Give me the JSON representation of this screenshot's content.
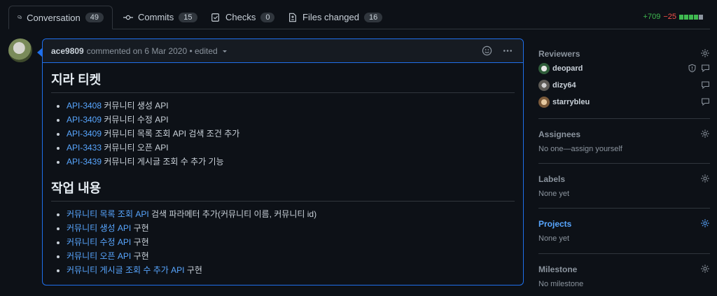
{
  "tabs": [
    {
      "label": "Conversation",
      "count": "49",
      "icon": "comment-discussion-icon"
    },
    {
      "label": "Commits",
      "count": "15",
      "icon": "commit-icon"
    },
    {
      "label": "Checks",
      "count": "0",
      "icon": "checklist-icon"
    },
    {
      "label": "Files changed",
      "count": "16",
      "icon": "file-diff-icon"
    }
  ],
  "diffstat": {
    "additions": "+709",
    "deletions": "−25"
  },
  "comment": {
    "author": "ace9809",
    "meta": "commented on 6 Mar 2020 • edited",
    "heading1": "지라 티켓",
    "tickets": [
      {
        "key": "API-3408",
        "text": " 커뮤니티 생성 API"
      },
      {
        "key": "API-3409",
        "text": " 커뮤니티 수정 API"
      },
      {
        "key": "API-3409",
        "text": " 커뮤니티 목록 조회 API 검색 조건 추가"
      },
      {
        "key": "API-3433",
        "text": " 커뮤니티 오픈 API"
      },
      {
        "key": "API-3439",
        "text": " 커뮤니티 게시글 조회 수 추가 기능"
      }
    ],
    "heading2": "작업 내용",
    "work": [
      {
        "link": "커뮤니티 목록 조회 API",
        "text": " 검색 파라메터 추가(커뮤니티 이름, 커뮤니티 id)"
      },
      {
        "link": "커뮤니티 생성 API",
        "text": " 구현"
      },
      {
        "link": "커뮤니티 수정 API",
        "text": " 구현"
      },
      {
        "link": "커뮤니티 오픈 API",
        "text": " 구현"
      },
      {
        "link": "커뮤니티 게시글 조회 수 추가 API",
        "text": " 구현"
      }
    ]
  },
  "sidebar": {
    "reviewers": {
      "title": "Reviewers",
      "people": [
        {
          "name": "deopard"
        },
        {
          "name": "dizy64"
        },
        {
          "name": "starrybleu"
        }
      ]
    },
    "assignees": {
      "title": "Assignees",
      "value": "No one—assign yourself"
    },
    "labels": {
      "title": "Labels",
      "value": "None yet"
    },
    "projects": {
      "title": "Projects",
      "value": "None yet"
    },
    "milestone": {
      "title": "Milestone",
      "value": "No milestone"
    }
  },
  "colors": {
    "accent": "#58a6ff",
    "focus_border": "#1f6feb",
    "add": "#3fb950",
    "del": "#f85149"
  }
}
